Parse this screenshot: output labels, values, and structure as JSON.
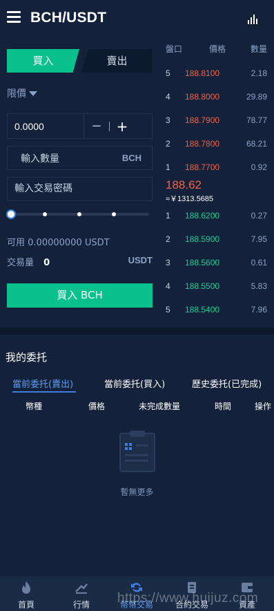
{
  "header": {
    "title": "BCH/USDT",
    "menu_icon": "menu-icon",
    "chart_icon": "bar-chart-icon"
  },
  "trade": {
    "tab_buy": "買入",
    "tab_sell": "賣出",
    "order_type": "限價",
    "price_value": "0.0000",
    "minus": "−",
    "plus": "+",
    "amount_placeholder": "輸入數量",
    "amount_unit": "BCH",
    "password_placeholder": "輸入交易密碼",
    "slider_level": 0,
    "available_label": "可用",
    "available_value": "0.00000000",
    "available_unit": "USDT",
    "volume_label": "交易量",
    "volume_value": "0",
    "volume_unit": "USDT",
    "submit_label": "買入 BCH",
    "accent_color": "#08c18c"
  },
  "orderbook": {
    "headers": {
      "level": "盤口",
      "price": "價格",
      "qty": "數量"
    },
    "asks": [
      {
        "idx": "5",
        "price": "188.8100",
        "qty": "2.18"
      },
      {
        "idx": "4",
        "price": "188.8000",
        "qty": "29.89"
      },
      {
        "idx": "3",
        "price": "188.7900",
        "qty": "78.77"
      },
      {
        "idx": "2",
        "price": "188.7800",
        "qty": "68.21"
      },
      {
        "idx": "1",
        "price": "188.7700",
        "qty": "0.92"
      }
    ],
    "last_price": "188.62",
    "last_cny": "≈￥1313.5685",
    "bids": [
      {
        "idx": "1",
        "price": "188.6200",
        "qty": "0.27"
      },
      {
        "idx": "2",
        "price": "188.5900",
        "qty": "7.95"
      },
      {
        "idx": "3",
        "price": "188.5600",
        "qty": "0.61"
      },
      {
        "idx": "4",
        "price": "188.5500",
        "qty": "5.83"
      },
      {
        "idx": "5",
        "price": "188.5400",
        "qty": "7.96"
      }
    ],
    "ask_color": "#f1624b",
    "bid_color": "#17cf94"
  },
  "orders": {
    "title": "我的委托",
    "tabs": [
      "當前委托(賣出)",
      "當前委托(買入)",
      "歷史委托(已完成)"
    ],
    "active_tab": 0,
    "columns": [
      "幣種",
      "價格",
      "未完成數量",
      "時間",
      "操作"
    ],
    "empty_text": "暫無更多"
  },
  "nav": {
    "items": [
      {
        "label": "首頁",
        "icon": "flame-icon"
      },
      {
        "label": "行情",
        "icon": "trend-icon"
      },
      {
        "label": "幣幣交易",
        "icon": "exchange-icon"
      },
      {
        "label": "合約交易",
        "icon": "contract-icon"
      },
      {
        "label": "資產",
        "icon": "wallet-icon"
      }
    ],
    "active_index": 2
  },
  "watermark": "https://www.huijuz.com"
}
